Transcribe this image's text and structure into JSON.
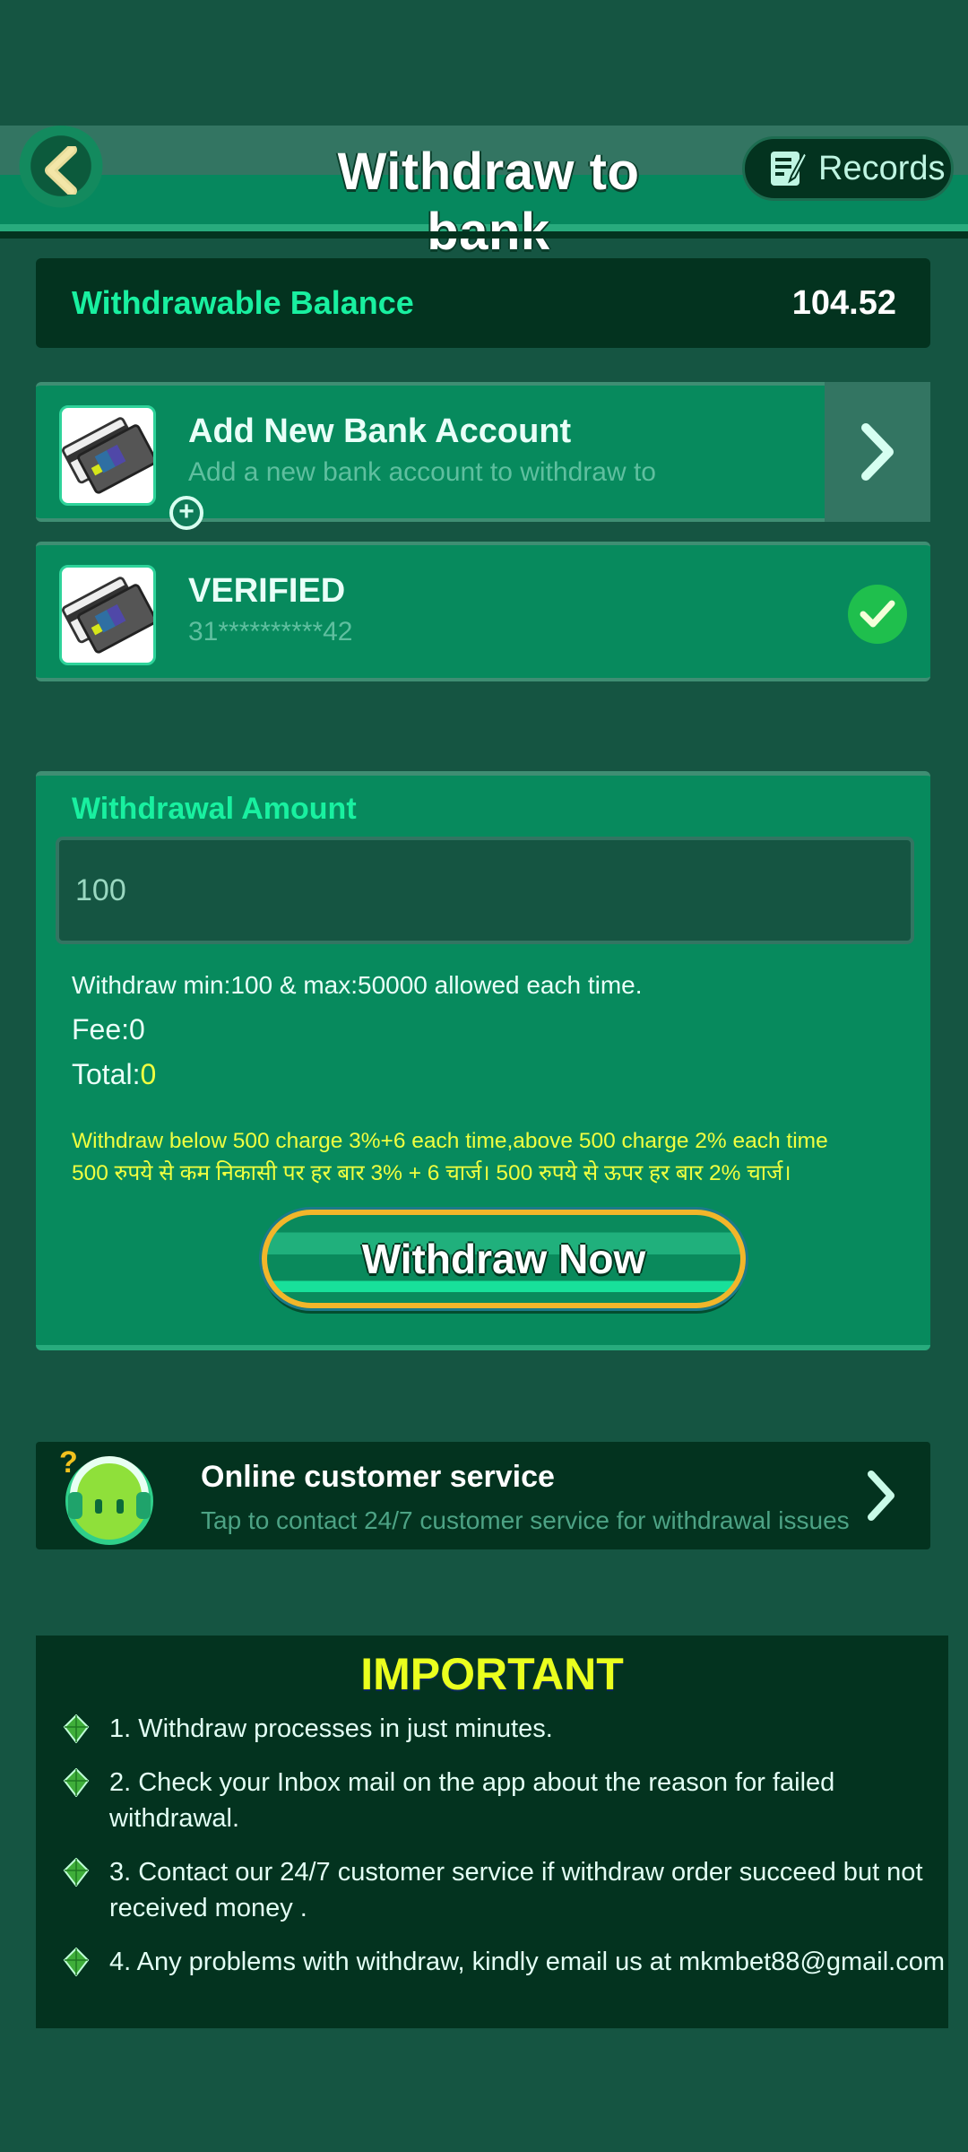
{
  "header": {
    "title": "Withdraw to bank",
    "back_icon": "chevron-left-icon",
    "records_label": "Records",
    "records_icon": "records-edit-icon"
  },
  "balance": {
    "label": "Withdrawable Balance",
    "value": "104.52"
  },
  "bank_accounts": {
    "add": {
      "title": "Add New Bank Account",
      "subtitle": "Add a new bank account to withdraw to",
      "icon": "bank-card-add-icon",
      "action_icon": "chevron-right-icon"
    },
    "verified": {
      "title": "VERIFIED",
      "account_masked": "31**********42",
      "icon": "bank-card-icon",
      "status_icon": "check-circle-icon",
      "selected": true
    }
  },
  "withdrawal": {
    "title": "Withdrawal Amount",
    "amount_value": "100",
    "amount_placeholder": "100",
    "limits_text": "Withdraw min:100 & max:50000 allowed each time.",
    "fee_label": "Fee:",
    "fee_value": "0",
    "total_label": "Total:",
    "total_value": "0",
    "fee_note_en": "Withdraw below 500 charge 3%+6 each time,above 500 charge 2% each time",
    "fee_note_hi": "500 रुपये से कम निकासी पर हर बार 3% + 6 चार्ज। 500 रुपये से ऊपर हर बार 2% चार्ज।",
    "submit_label": "Withdraw Now"
  },
  "customer_service": {
    "title": "Online customer service",
    "subtitle": "Tap to contact 24/7 customer service for withdrawal issues",
    "icon": "headset-support-icon",
    "action_icon": "chevron-right-icon"
  },
  "important": {
    "title": "IMPORTANT",
    "bullet_icon": "gem-bullet-icon",
    "items": [
      "1. Withdraw processes in just minutes.",
      "2. Check your Inbox mail on the app about the reason for failed withdrawal.",
      "3. Contact our 24/7 customer service if withdraw order succeed but not received money .",
      "4. Any problems with withdraw, kindly email us at mkmbet88@gmail.com"
    ]
  },
  "colors": {
    "background": "#155542",
    "panel": "#078a5d",
    "dark_panel": "#03331f",
    "accent_green": "#19f0a0",
    "accent_yellow": "#f0ff40",
    "button_border_gold": "#f2b62a"
  }
}
